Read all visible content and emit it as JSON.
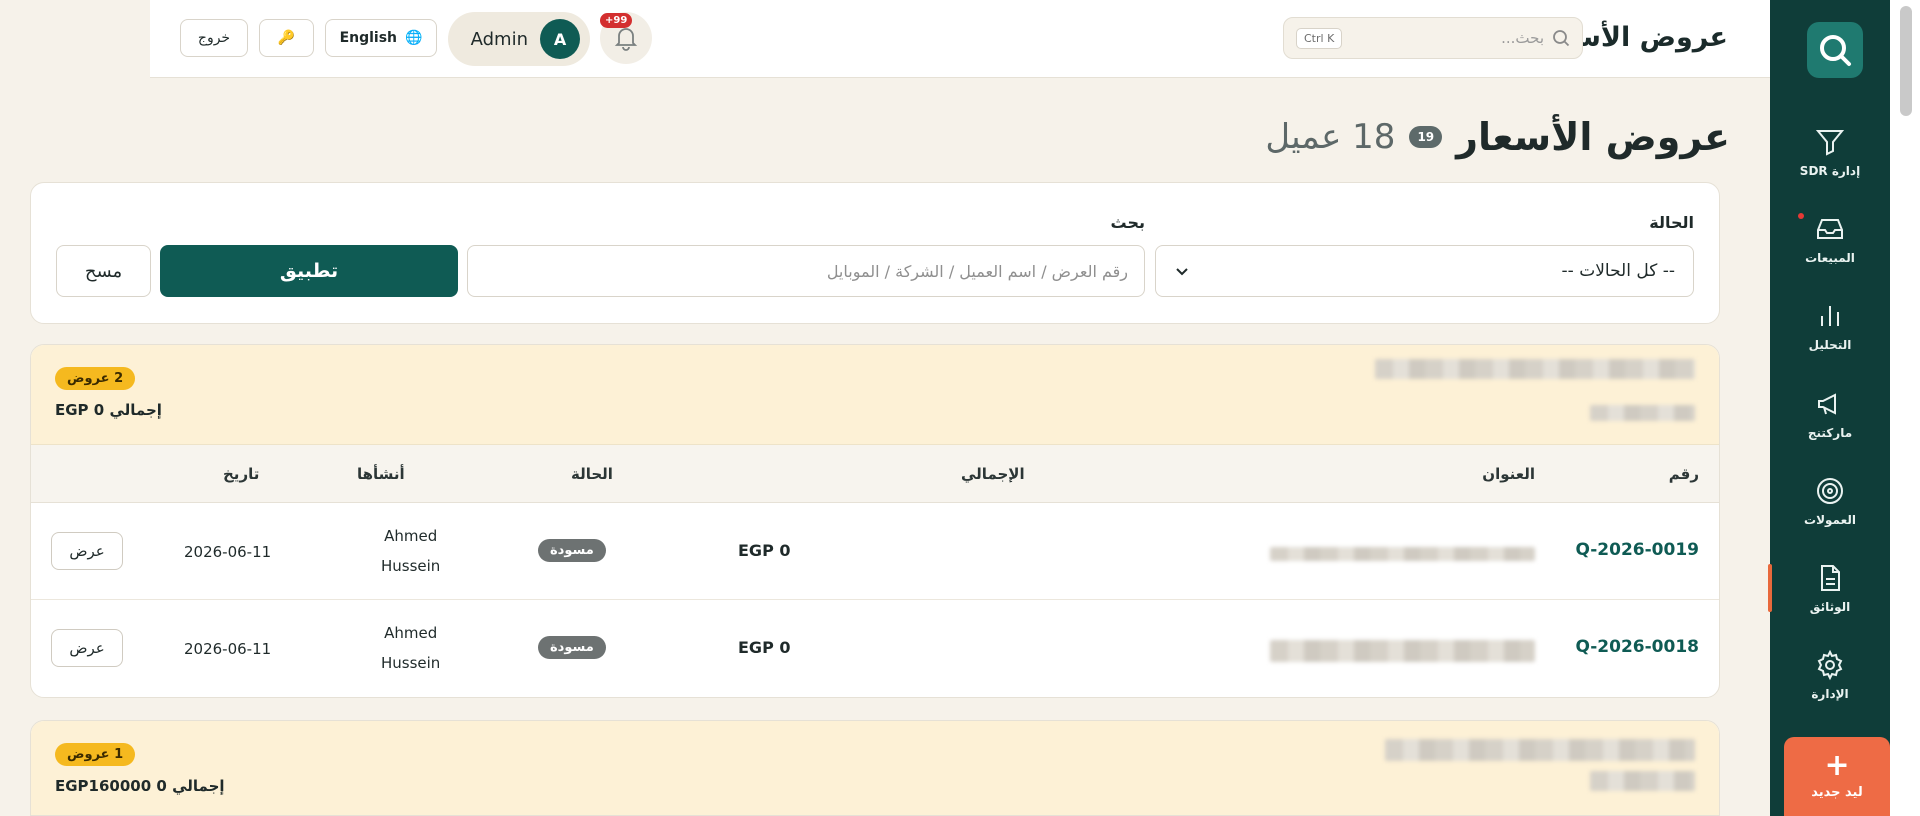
{
  "sidebar": {
    "items": [
      {
        "label": "إدارة SDR",
        "icon": "filter-icon"
      },
      {
        "label": "المبيعات",
        "icon": "inbox-icon"
      },
      {
        "label": "التحليل",
        "icon": "bar-chart-icon"
      },
      {
        "label": "ماركتنج",
        "icon": "megaphone-icon"
      },
      {
        "label": "العمولات",
        "icon": "target-icon"
      },
      {
        "label": "الوثائق",
        "icon": "document-icon"
      },
      {
        "label": "الإدارة",
        "icon": "gear-icon"
      }
    ],
    "active_index": 5,
    "new_lead_label": "ليد جديد"
  },
  "topbar": {
    "app_title": "عروض الأسعار",
    "search_placeholder": "بحث...",
    "search_shortcut": "Ctrl K",
    "notifications_badge": "+99",
    "user_initial": "A",
    "user_name": "Admin",
    "language_label": "English",
    "logout_label": "خروج"
  },
  "page": {
    "title": "عروض الأسعار",
    "count": "19",
    "clients_label": "18 عميل"
  },
  "filters": {
    "status_label": "الحالة",
    "status_value": "-- كل الحالات --",
    "search_label": "بحث",
    "search_placeholder": "رقم العرض / اسم العميل / الشركة / الموبايل",
    "apply_label": "تطبيق",
    "clear_label": "مسح"
  },
  "table_headers": {
    "number": "رقم",
    "title": "العنوان",
    "total": "الإجمالي",
    "status": "الحالة",
    "created_by": "أنشأها",
    "date": "تاريخ"
  },
  "groups": [
    {
      "offers_badge": "2 عروض",
      "total_line": "إجمالي EGP 0",
      "rows": [
        {
          "number": "Q-2026-0019",
          "total": "EGP 0",
          "status": "مسودة",
          "creator_first": "Ahmed",
          "creator_last": "Hussein",
          "date": "2026-06-11",
          "action": "عرض"
        },
        {
          "number": "Q-2026-0018",
          "total": "EGP 0",
          "status": "مسودة",
          "creator_first": "Ahmed",
          "creator_last": "Hussein",
          "date": "2026-06-11",
          "action": "عرض"
        }
      ]
    },
    {
      "offers_badge": "1 عروض",
      "total_line": "إجمالي EGP160000 0"
    }
  ],
  "colors": {
    "sidebar": "#0f3d39",
    "primary": "#0f5b54",
    "accent": "#ee6b45",
    "badge_yellow": "#f5b91f"
  }
}
